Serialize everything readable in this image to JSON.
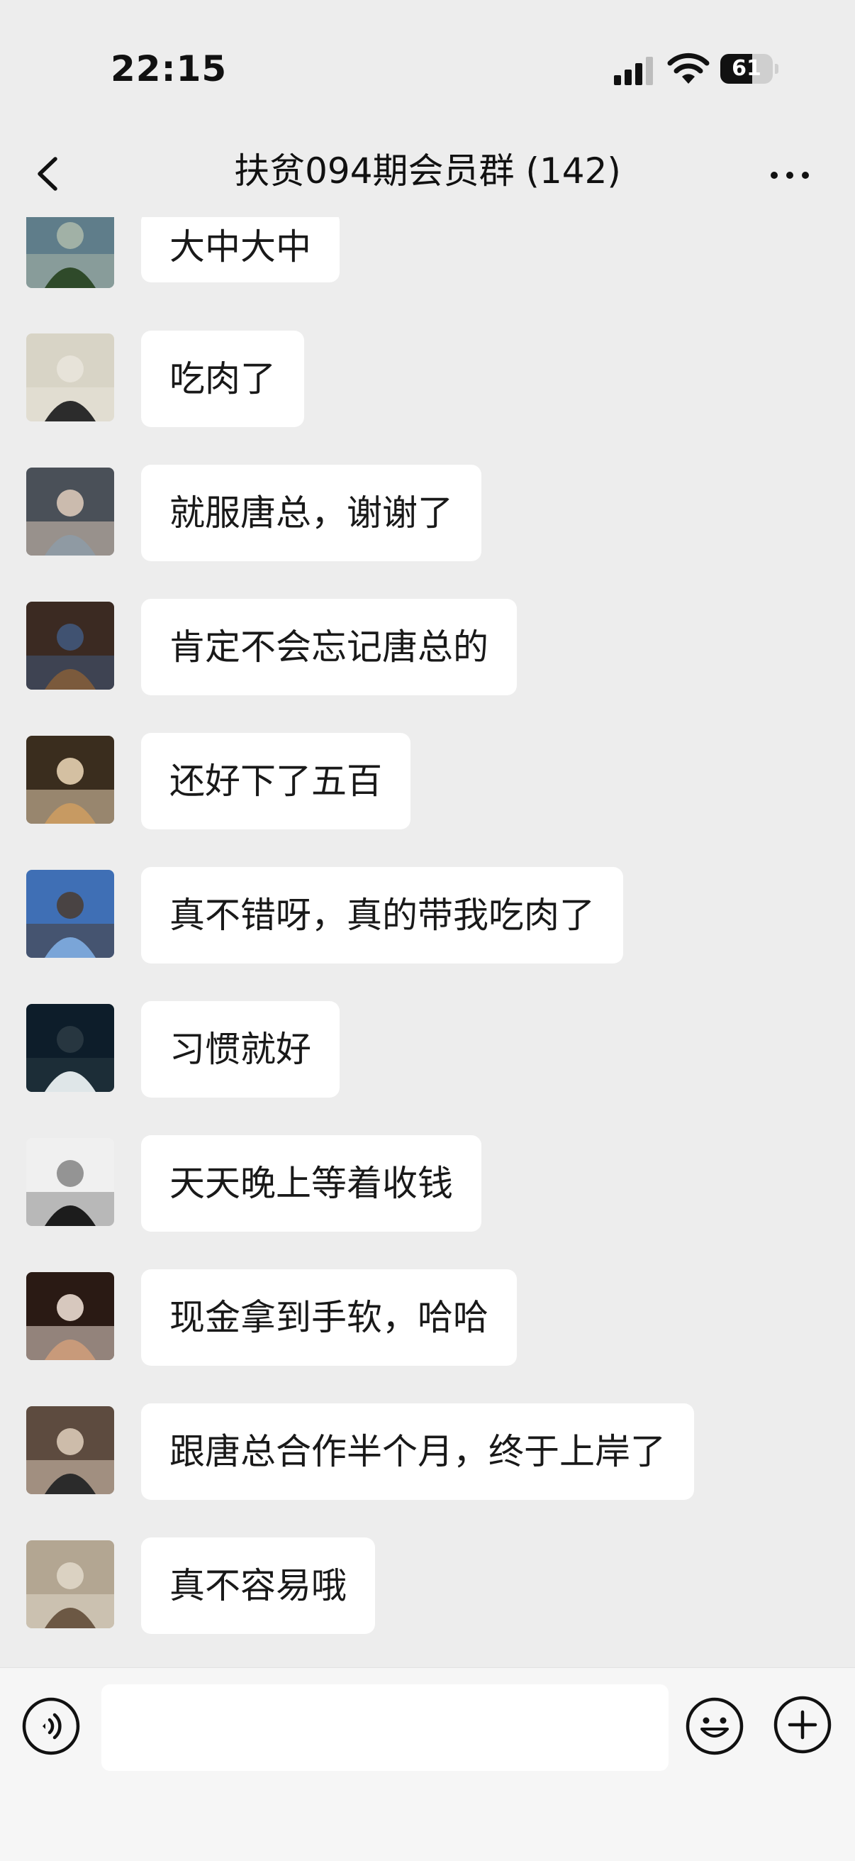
{
  "status_bar": {
    "time": "22:15",
    "battery_level": "61",
    "battery_fraction": 0.61,
    "icons": [
      "cellular-signal-icon",
      "wifi-icon",
      "battery-icon"
    ]
  },
  "header": {
    "title": "扶贫094期会员群 (142)",
    "back_icon": "chevron-left-icon",
    "more_icon": "more-dots-icon"
  },
  "messages": [
    {
      "text": "大中大中",
      "avatar_colors": [
        "#5f7d8a",
        "#2f4a2a",
        "#a9b7a8"
      ]
    },
    {
      "text": "吃肉了",
      "avatar_colors": [
        "#d8d4c6",
        "#2c2c2c",
        "#e9e4da"
      ]
    },
    {
      "text": "就服唐总，谢谢了",
      "avatar_colors": [
        "#4a5058",
        "#8f9aa3",
        "#d9c7b8"
      ]
    },
    {
      "text": "肯定不会忘记唐总的",
      "avatar_colors": [
        "#3b2a22",
        "#7b5a3c",
        "#41577a"
      ]
    },
    {
      "text": "还好下了五百",
      "avatar_colors": [
        "#3a2d1e",
        "#c79a62",
        "#e6d0b0"
      ]
    },
    {
      "text": "真不错呀，真的带我吃肉了",
      "avatar_colors": [
        "#3f6fb5",
        "#7aa5d8",
        "#4a3e36"
      ]
    },
    {
      "text": "习惯就好",
      "avatar_colors": [
        "#0d1d2a",
        "#dfe6e8",
        "#2a3a42"
      ]
    },
    {
      "text": "天天晚上等着收钱",
      "avatar_colors": [
        "#f0f0f0",
        "#1c1c1c",
        "#8a8a8a"
      ]
    },
    {
      "text": "现金拿到手软，哈哈",
      "avatar_colors": [
        "#2a1a14",
        "#c89a7a",
        "#eadbd0"
      ]
    },
    {
      "text": "跟唐总合作半个月，终于上岸了",
      "avatar_colors": [
        "#5d4b3f",
        "#2b2b2b",
        "#d9c9b6"
      ]
    },
    {
      "text": "真不容易哦",
      "avatar_colors": [
        "#b3a692",
        "#6c5844",
        "#dfd7c8"
      ]
    }
  ],
  "input_bar": {
    "placeholder": "",
    "voice_icon": "voice-icon",
    "emoji_icon": "emoji-icon",
    "plus_icon": "plus-icon"
  }
}
